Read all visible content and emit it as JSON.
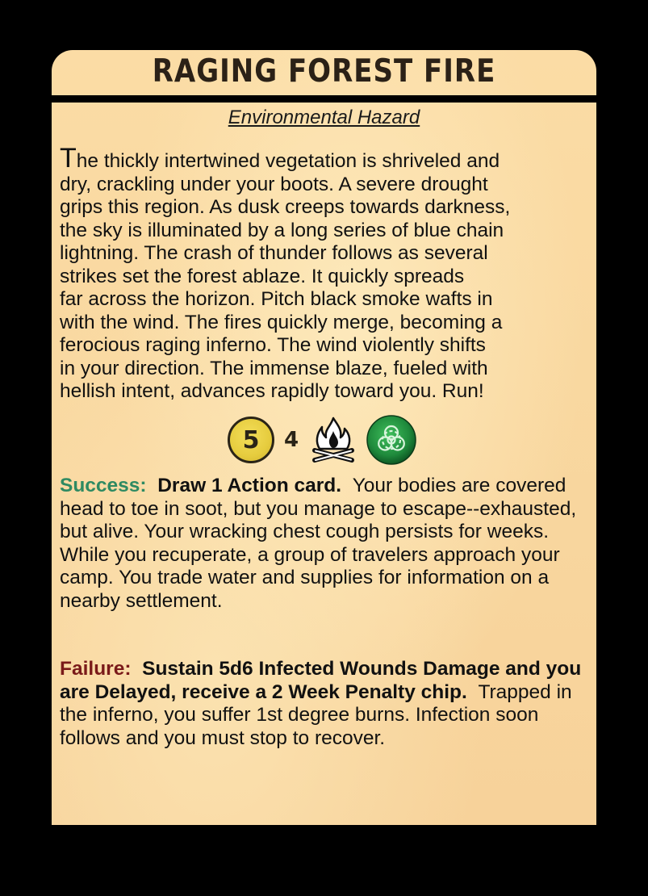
{
  "card": {
    "title": "RAGING FOREST FIRE",
    "subtitle": "Environmental Hazard",
    "flavor_dropcap": "T",
    "flavor_text": "he thickly intertwined vegetation is shriveled and\ndry, crackling under your boots.  A severe drought\ngrips this region.  As dusk creeps towards darkness,\nthe sky is illuminated by a long series of blue chain\nlightning.  The crash of thunder follows as several\nstrikes set the forest ablaze.  It quickly spreads\nfar across the horizon.  Pitch black smoke wafts in\nwith the wind.  The fires quickly merge, becoming a\nferocious raging inferno.  The wind violently shifts\nin your direction.  The immense blaze, fueled with\nhellish intent, advances rapidly toward you.  Run!",
    "test": {
      "difficulty": "5",
      "dice": "4",
      "icons": [
        "campfire-icon",
        "biohazard-icon"
      ]
    },
    "success": {
      "label": "Success:",
      "effect": "Draw 1 Action card.",
      "text": "Your bodies are covered head to toe in soot, but you manage to escape--exhausted, but alive.  Your wracking chest cough persists for weeks.  While you recuperate, a group of travelers approach your camp.  You trade water and supplies for information on a nearby settlement."
    },
    "failure": {
      "label": "Failure:",
      "effect": "Sustain 5d6 Infected Wounds Damage and you are Delayed,  receive a 2 Week Penalty chip.",
      "text": "Trapped in the inferno, you suffer 1st degree burns.  Infection soon follows and you must stop to recover."
    }
  },
  "colors": {
    "background": "#000000",
    "parchment": "#fbdca5",
    "success": "#2e8a62",
    "failure": "#7a1a1a",
    "token": "#e6cc3e",
    "biohazard": "#1f8a3c"
  }
}
